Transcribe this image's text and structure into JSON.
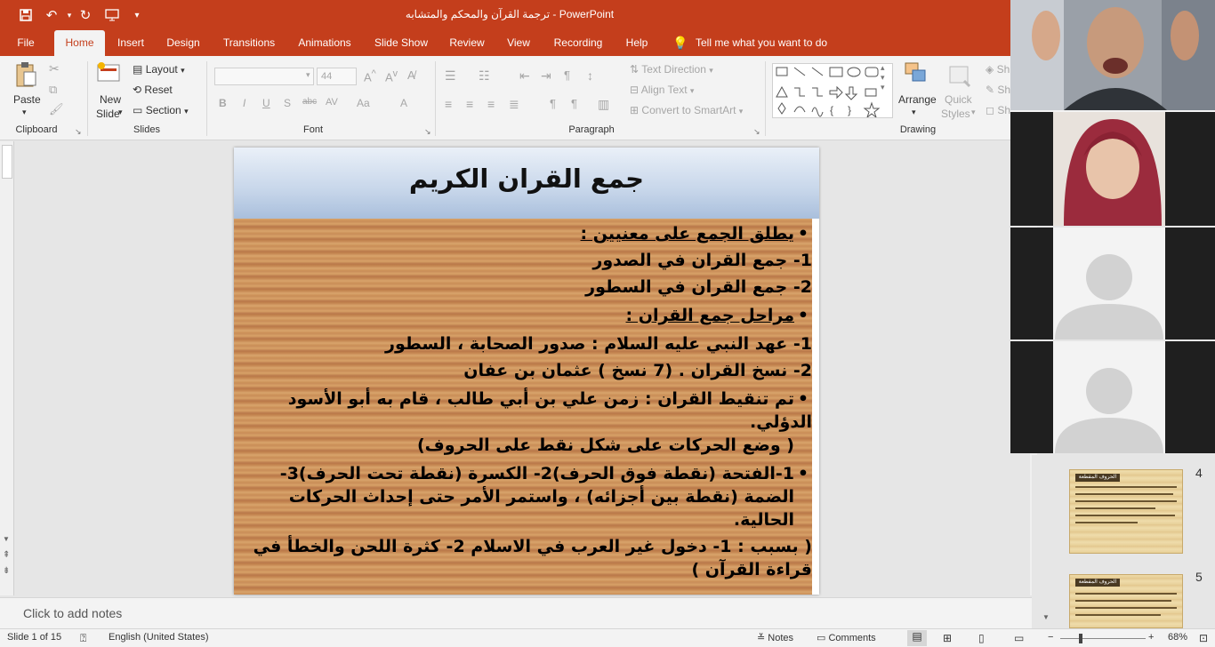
{
  "window": {
    "title": "ترجمة القرآن والمحكم والمتشابه  -  PowerPoint"
  },
  "tabs": [
    "File",
    "Home",
    "Insert",
    "Design",
    "Transitions",
    "Animations",
    "Slide Show",
    "Review",
    "View",
    "Recording",
    "Help"
  ],
  "tell_me": "Tell me what you want to do",
  "ribbon": {
    "clipboard": {
      "paste": "Paste",
      "label": "Clipboard"
    },
    "slides": {
      "new_slide": "New",
      "new_slide2": "Slide",
      "layout": "Layout",
      "reset": "Reset",
      "section": "Section",
      "label": "Slides"
    },
    "font": {
      "size": "44",
      "bold": "B",
      "italic": "I",
      "underline": "U",
      "shadow": "S",
      "strike": "abc",
      "spacing": "AV",
      "case": "Aa",
      "color": "A",
      "label": "Font"
    },
    "paragraph": {
      "text_direction": "Text Direction",
      "align_text": "Align Text",
      "smartart": "Convert to SmartArt",
      "label": "Paragraph"
    },
    "drawing": {
      "arrange": "Arrange",
      "quick_styles": "Quick",
      "quick_styles2": "Styles",
      "label": "Drawing",
      "sh1": "Sh",
      "sh2": "Sh",
      "sh3": "Sh"
    }
  },
  "slide": {
    "title": "جمع القران الكريم",
    "lines": [
      "يطلق الجمع على معنيين :",
      "1- جمع القران في الصدور",
      "2- جمع القران في السطور",
      "مراحل جمع القران :",
      "1- عهد النبي عليه السلام : صدور الصحابة ، السطور",
      "2- نسخ القران . (7 نسخ ) عثمان بن عفان",
      "تم تنقيط القران : زمن علي بن أبي طالب ، قام به أبو الأسود الدؤلي.",
      "( وضع الحركات على شكل نقط على الحروف)",
      "1-الفتحة (نقطة فوق الحرف)2- الكسرة (نقطة تحت الحرف)3-",
      "الضمة (نقطة بين أجزائه) ، واستمر الأمر حتى إحداث الحركات",
      "الحالية.",
      "( بسبب : 1- دخول غير العرب في الاسلام 2- كثرة اللحن والخطأ في",
      "قراءة القرآن )"
    ]
  },
  "notes_placeholder": "Click to add notes",
  "thumbnails": [
    {
      "number": "4",
      "title": "الحروف المقطعة"
    },
    {
      "number": "5",
      "title": "الحروف المقطعة"
    }
  ],
  "status": {
    "slide": "Slide 1 of 15",
    "language": "English (United States)",
    "notes": "Notes",
    "comments": "Comments",
    "zoom": "68%",
    "zoom_level": 0.68
  },
  "colors": {
    "accent": "#c43e1c",
    "ribbon": "#f3f3f3"
  }
}
